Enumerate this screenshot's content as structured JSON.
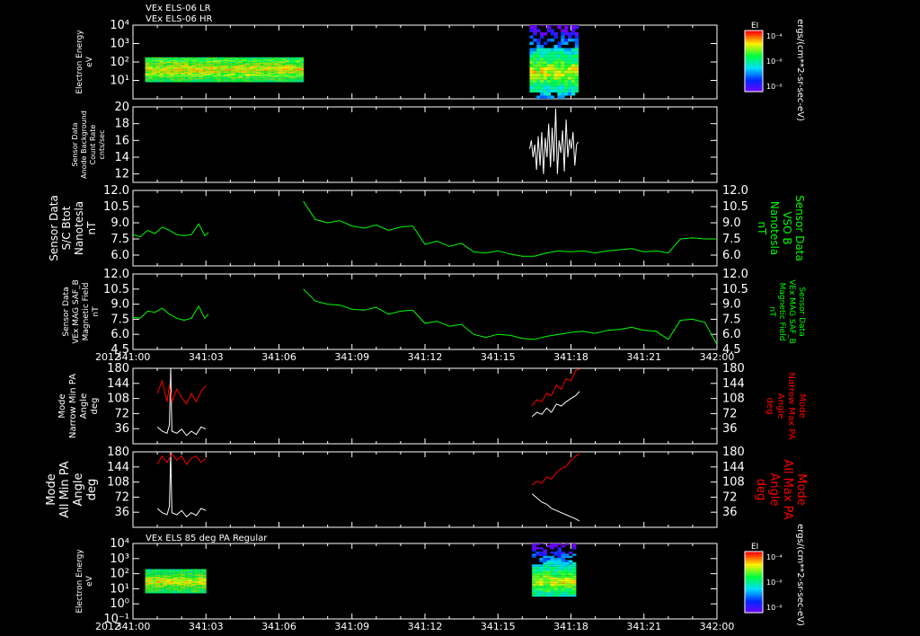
{
  "header": {
    "line1": "VEx ELS-06 LR",
    "line2": "VEx ELS-06 HR"
  },
  "colors": {
    "background": "#000000",
    "frame": "#ffffff",
    "green": "#00ff00",
    "red": "#ff0000",
    "white": "#ffffff"
  },
  "time_axis": {
    "year": "2012",
    "ticks": [
      "341:00",
      "341:03",
      "341:06",
      "341:09",
      "341:12",
      "341:15",
      "341:18",
      "341:21",
      "342:00"
    ],
    "minor_per_major": 3
  },
  "colorbar": {
    "unit": "ergs/(cm**2-sr-sec-eV)",
    "top_panel": {
      "label": "EI",
      "ticks": [
        "10⁻⁴",
        "10⁻⁶",
        "10⁻⁸"
      ]
    },
    "bottom_panel": {
      "label": "EI",
      "ticks": [
        "10⁻⁴",
        "10⁻⁶",
        "10⁻⁸"
      ]
    }
  },
  "panels": {
    "p1": {
      "left_label": [
        "Electron Energy",
        "eV"
      ],
      "ticks": [
        "10⁴",
        "10³",
        "10²",
        "10¹"
      ]
    },
    "p2": {
      "left_label": [
        "Sensor Data",
        "Anode Background",
        "Count Rate",
        "cnts/sec"
      ],
      "ticks": [
        "20",
        "18",
        "16",
        "14",
        "12"
      ]
    },
    "p3": {
      "left_label": [
        "Sensor Data",
        "S/C Btot",
        "Nanotesla",
        "nT"
      ],
      "right_label": [
        "Sensor Data",
        "VSO B",
        "Nanotesla",
        "nT"
      ],
      "ticks": [
        "12.0",
        "10.5",
        "9.0",
        "7.5",
        "6.0"
      ]
    },
    "p4": {
      "left_label": [
        "Sensor Data",
        "VEx MAG SAF_B",
        "Magnetic Field",
        "nT"
      ],
      "right_label": [
        "Sensor Data",
        "VEx MAG SAF_B",
        "Magnetic Field",
        "nT"
      ],
      "ticks": [
        "12.0",
        "10.5",
        "9.0",
        "7.5",
        "6.0",
        "4.5"
      ]
    },
    "p5": {
      "left_label": [
        "Mode",
        "Narrow Min PA",
        "Angle",
        "deg"
      ],
      "right_label": [
        "Mode",
        "Narrow Max PA",
        "Angle",
        "deg"
      ],
      "ticks": [
        "180",
        "144",
        "108",
        "72",
        "36"
      ]
    },
    "p6": {
      "left_label": [
        "Mode",
        "All Min PA",
        "Angle",
        "deg"
      ],
      "right_label": [
        "Mode",
        "All Max PA",
        "Angle",
        "deg"
      ],
      "ticks": [
        "180",
        "144",
        "108",
        "72",
        "36"
      ]
    },
    "p7": {
      "title": "VEx ELS 85 deg PA Regular",
      "left_label": [
        "Electron Energy",
        "eV"
      ],
      "ticks": [
        "10⁴",
        "10³",
        "10²",
        "10¹",
        "10⁰",
        "10⁻¹"
      ]
    }
  },
  "chart_data": [
    {
      "type": "heatmap",
      "ylabel": "Electron Energy eV",
      "yscale": "log",
      "ylim": [
        1,
        10000
      ],
      "blocks": [
        {
          "t_start": "341:00.5",
          "t_end": "341:07",
          "e_min": 8,
          "e_max": 180,
          "peak_e": 40
        },
        {
          "t_start": "341:16.3",
          "t_end": "341:18.3",
          "e_min": 1,
          "e_max": 30000,
          "peak_e": 30
        }
      ]
    },
    {
      "type": "line",
      "ylabel": "Sensor Data Anode Background Count Rate cnts/sec",
      "ylim": [
        11,
        20
      ],
      "x_start_min": 16.3,
      "x_end_min": 18.3,
      "y": [
        15,
        16,
        14,
        15.5,
        12.5,
        16.5,
        13,
        17,
        12,
        16.3,
        14,
        18,
        12.8,
        17.5,
        13.5,
        19.8,
        12,
        16,
        14.5,
        17.2,
        12.3,
        18.5,
        14,
        16.2,
        15,
        17,
        13,
        15.5,
        15.8
      ]
    },
    {
      "type": "line",
      "ylabel": "Sensor Data S/C Btot Nanotesla nT",
      "ylim": [
        5.0,
        12.0
      ],
      "series": [
        {
          "x": [
            0,
            0.3,
            0.6,
            0.9,
            1.2,
            1.5,
            1.8,
            2.1,
            2.4,
            2.7,
            2.95,
            3.1
          ],
          "y": [
            7.9,
            7.7,
            8.3,
            8.0,
            8.6,
            8.3,
            7.9,
            7.8,
            7.9,
            8.9,
            7.8,
            8.1
          ]
        },
        {
          "x": [
            7.0,
            7.5,
            8.0,
            8.5,
            9.0,
            9.5,
            10.0,
            10.5,
            11.0,
            11.5,
            12.0,
            12.5,
            13.0,
            13.5,
            14.0,
            14.5,
            15.0,
            15.5,
            16.0,
            16.5,
            17.0,
            17.5,
            18.0,
            18.5,
            19.0,
            19.5,
            20.0,
            20.5,
            21.0,
            21.5,
            22.0,
            22.5,
            23.0,
            23.5,
            24.0
          ],
          "y": [
            11.0,
            9.3,
            9.0,
            9.2,
            8.7,
            8.5,
            8.8,
            8.3,
            8.6,
            8.7,
            7.0,
            7.3,
            6.8,
            7.1,
            6.3,
            6.2,
            6.4,
            6.1,
            5.9,
            5.9,
            6.2,
            6.4,
            6.3,
            6.4,
            6.2,
            6.4,
            6.5,
            6.6,
            6.3,
            6.4,
            6.2,
            7.5,
            7.6,
            7.5,
            7.5
          ]
        }
      ]
    },
    {
      "type": "line",
      "ylabel": "Sensor Data VEx MAG SAF_B Magnetic Field nT",
      "ylim": [
        4.5,
        12.0
      ],
      "series": [
        {
          "x": [
            0,
            0.3,
            0.6,
            0.9,
            1.2,
            1.5,
            1.8,
            2.1,
            2.4,
            2.7,
            2.95,
            3.1
          ],
          "y": [
            7.7,
            7.6,
            8.3,
            8.2,
            8.6,
            8.0,
            7.6,
            7.4,
            7.6,
            8.8,
            7.6,
            8.0
          ]
        },
        {
          "x": [
            7.0,
            7.5,
            8.0,
            8.5,
            9.0,
            9.5,
            10.0,
            10.5,
            11.0,
            11.5,
            12.0,
            12.5,
            13.0,
            13.5,
            14.0,
            14.5,
            15.0,
            15.5,
            16.0,
            16.5,
            17.0,
            17.5,
            18.0,
            18.5,
            19.0,
            19.5,
            20.0,
            20.5,
            21.0,
            21.5,
            22.0,
            22.5,
            23.0,
            23.5,
            24.0
          ],
          "y": [
            10.5,
            9.3,
            9.0,
            8.9,
            8.5,
            8.4,
            8.7,
            8.0,
            8.3,
            8.4,
            7.1,
            7.3,
            6.8,
            7.0,
            6.0,
            5.7,
            6.0,
            5.9,
            5.6,
            5.5,
            5.8,
            6.0,
            6.2,
            6.3,
            6.1,
            6.4,
            6.5,
            6.7,
            6.4,
            6.3,
            5.5,
            7.4,
            7.5,
            7.2,
            5.0
          ]
        }
      ]
    },
    {
      "type": "line",
      "ylabel": "Mode Narrow Min PA Angle deg",
      "ylim": [
        0,
        180
      ],
      "series": [
        {
          "name": "Narrow Min PA",
          "color": "white",
          "x": [
            1.0,
            1.2,
            1.4,
            1.5,
            1.55,
            1.6,
            1.8,
            2.0,
            2.2,
            2.4,
            2.6,
            2.8,
            3.0
          ],
          "y": [
            40,
            30,
            25,
            45,
            180,
            30,
            25,
            35,
            20,
            30,
            22,
            40,
            35
          ]
        },
        {
          "name": "Narrow Max PA",
          "color": "red",
          "x": [
            1.0,
            1.2,
            1.4,
            1.5,
            1.6,
            1.8,
            2.0,
            2.2,
            2.4,
            2.6,
            2.8,
            3.0
          ],
          "y": [
            120,
            150,
            100,
            140,
            100,
            130,
            110,
            95,
            120,
            100,
            125,
            140
          ]
        },
        {
          "name": "Narrow Min PA",
          "color": "white",
          "x": [
            16.4,
            16.6,
            16.8,
            17.0,
            17.2,
            17.4,
            17.6,
            17.8,
            18.0,
            18.2,
            18.35
          ],
          "y": [
            65,
            75,
            70,
            85,
            75,
            95,
            90,
            100,
            108,
            115,
            125
          ]
        },
        {
          "name": "Narrow Max PA",
          "color": "red",
          "x": [
            16.4,
            16.6,
            16.8,
            17.0,
            17.2,
            17.4,
            17.6,
            17.8,
            18.0,
            18.2,
            18.35
          ],
          "y": [
            90,
            105,
            100,
            120,
            115,
            140,
            130,
            155,
            150,
            175,
            178
          ]
        }
      ]
    },
    {
      "type": "line",
      "ylabel": "Mode All Min PA Angle deg",
      "ylim": [
        0,
        180
      ],
      "series": [
        {
          "name": "All Min PA",
          "color": "white",
          "x": [
            1.0,
            1.2,
            1.4,
            1.5,
            1.55,
            1.6,
            1.8,
            2.0,
            2.2,
            2.4,
            2.6,
            2.8,
            3.0
          ],
          "y": [
            45,
            35,
            30,
            50,
            180,
            35,
            30,
            40,
            25,
            35,
            28,
            45,
            40
          ]
        },
        {
          "name": "All Max PA",
          "color": "red",
          "x": [
            1.0,
            1.2,
            1.4,
            1.6,
            1.8,
            2.0,
            2.2,
            2.4,
            2.6,
            2.8,
            3.0
          ],
          "y": [
            150,
            170,
            155,
            175,
            160,
            170,
            150,
            165,
            170,
            155,
            165
          ]
        },
        {
          "name": "All Min PA",
          "color": "white",
          "x": [
            16.4,
            16.6,
            16.8,
            17.0,
            17.2,
            17.4,
            17.6,
            17.8,
            18.0,
            18.2,
            18.35
          ],
          "y": [
            80,
            70,
            60,
            55,
            45,
            40,
            35,
            30,
            25,
            20,
            15
          ]
        },
        {
          "name": "All Max PA",
          "color": "red",
          "x": [
            16.4,
            16.6,
            16.8,
            17.0,
            17.2,
            17.4,
            17.6,
            17.8,
            18.0,
            18.2,
            18.35
          ],
          "y": [
            100,
            110,
            105,
            120,
            115,
            130,
            140,
            145,
            160,
            170,
            175
          ]
        }
      ]
    },
    {
      "type": "heatmap",
      "title": "VEx ELS 85 deg PA Regular",
      "ylabel": "Electron Energy eV",
      "yscale": "log",
      "ylim": [
        0.1,
        10000
      ],
      "blocks": [
        {
          "t_start": "341:00.5",
          "t_end": "341:03",
          "e_min": 5,
          "e_max": 200,
          "peak_e": 30
        },
        {
          "t_start": "341:16.4",
          "t_end": "341:18.2",
          "e_min": 3,
          "e_max": 15000,
          "peak_e": 30
        }
      ]
    }
  ]
}
